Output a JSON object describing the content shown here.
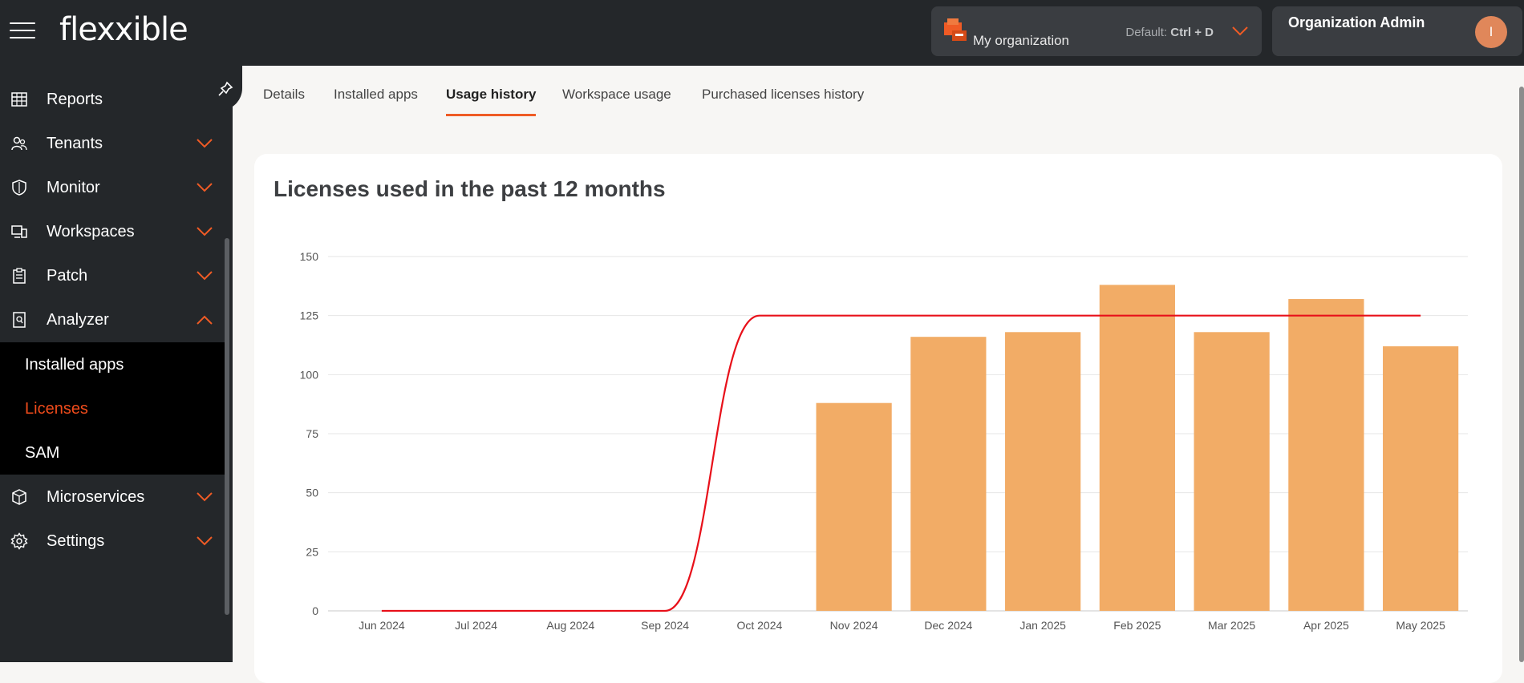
{
  "header": {
    "logo_text": "flexxible",
    "org": {
      "name": "My organization",
      "default_label": "Default:",
      "shortcut": "Ctrl + D"
    },
    "user": {
      "name": "Organization Admin",
      "avatar_initial": "I"
    }
  },
  "sidebar": {
    "items": [
      {
        "label": "Reports",
        "icon": "table-icon",
        "expandable": false
      },
      {
        "label": "Tenants",
        "icon": "users-icon",
        "expandable": true,
        "expanded": false
      },
      {
        "label": "Monitor",
        "icon": "shield-icon",
        "expandable": true,
        "expanded": false
      },
      {
        "label": "Workspaces",
        "icon": "devices-icon",
        "expandable": true,
        "expanded": false
      },
      {
        "label": "Patch",
        "icon": "clipboard-icon",
        "expandable": true,
        "expanded": false
      },
      {
        "label": "Analyzer",
        "icon": "analyzer-icon",
        "expandable": true,
        "expanded": true
      },
      {
        "label": "Microservices",
        "icon": "cube-icon",
        "expandable": true,
        "expanded": false
      },
      {
        "label": "Settings",
        "icon": "gear-icon",
        "expandable": true,
        "expanded": false
      }
    ],
    "analyzer_subitems": [
      {
        "label": "Installed apps",
        "active": false
      },
      {
        "label": "Licenses",
        "active": true
      },
      {
        "label": "SAM",
        "active": false
      }
    ]
  },
  "tabs": [
    {
      "label": "Details",
      "active": false
    },
    {
      "label": "Installed apps",
      "active": false
    },
    {
      "label": "Usage history",
      "active": true
    },
    {
      "label": "Workspace usage",
      "active": false
    },
    {
      "label": "Purchased licenses history",
      "active": false
    }
  ],
  "card": {
    "title": "Licenses used in the past 12 months"
  },
  "colors": {
    "accent": "#ef5b25",
    "bar": "#f2ac66",
    "line": "#e8101a",
    "sidebar_bg": "#24272a"
  },
  "chart_data": {
    "type": "bar",
    "title": "",
    "xlabel": "",
    "ylabel": "",
    "ylim": [
      0,
      150
    ],
    "yticks": [
      0,
      25,
      50,
      75,
      100,
      125,
      150
    ],
    "grid": true,
    "categories": [
      "Jun 2024",
      "Jul 2024",
      "Aug 2024",
      "Sep 2024",
      "Oct 2024",
      "Nov 2024",
      "Dec 2024",
      "Jan 2025",
      "Feb 2025",
      "Mar 2025",
      "Apr 2025",
      "May 2025"
    ],
    "series": [
      {
        "type": "bar",
        "values": [
          0,
          0,
          0,
          0,
          0,
          88,
          116,
          118,
          138,
          118,
          132,
          112
        ]
      },
      {
        "type": "line",
        "values": [
          0,
          0,
          0,
          0,
          125,
          125,
          125,
          125,
          125,
          125,
          125,
          125
        ]
      }
    ]
  }
}
